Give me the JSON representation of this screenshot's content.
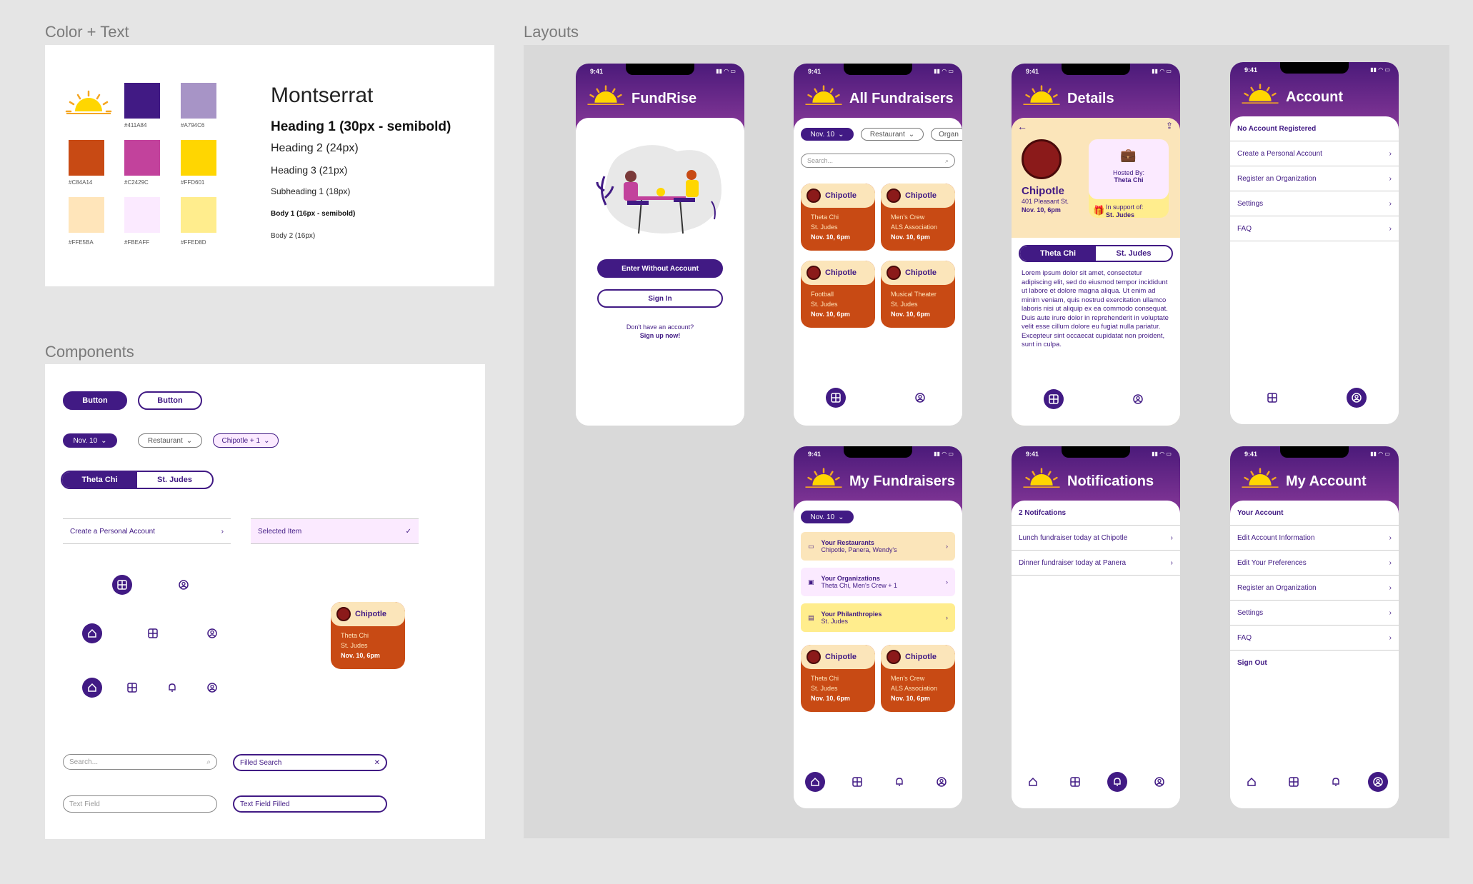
{
  "frames": {
    "color_text": "Color + Text",
    "components": "Components",
    "layouts": "Layouts"
  },
  "colors": [
    {
      "hex": "#411A84",
      "label": "#411A84"
    },
    {
      "hex": "#A794C6",
      "label": "#A794C6"
    },
    {
      "hex": "#C84A14",
      "label": "#C84A14"
    },
    {
      "hex": "#C2429C",
      "label": "#C2429C"
    },
    {
      "hex": "#FFD601",
      "label": "#FFD601"
    },
    {
      "hex": "#FFE5BA",
      "label": "#FFE5BA"
    },
    {
      "hex": "#FBEAFF",
      "label": "#FBEAFF"
    },
    {
      "hex": "#FFED8D",
      "label": "#FFED8D"
    }
  ],
  "typography": {
    "font": "Montserrat",
    "h1": "Heading 1 (30px - semibold)",
    "h2": "Heading 2 (24px)",
    "h3": "Heading 3 (21px)",
    "sub1": "Subheading 1 (18px)",
    "body1": "Body 1 (16px - semibold)",
    "body2": "Body 2 (16px)"
  },
  "components": {
    "button_filled": "Button",
    "button_outline": "Button",
    "date_pill": "Nov. 10",
    "restaurant_pill": "Restaurant",
    "chipotle_pill": "Chipotle + 1",
    "seg_left": "Theta Chi",
    "seg_right": "St. Judes",
    "list_item": "Create a Personal Account",
    "selected_item": "Selected Item",
    "card": {
      "name": "Chipotle",
      "org": "Theta Chi",
      "phil": "St. Judes",
      "time": "Nov. 10, 6pm"
    },
    "search_placeholder": "Search...",
    "search_filled": "Filled Search",
    "text_field": "Text Field",
    "text_field_filled": "Text Field Filled"
  },
  "status_time": "9:41",
  "screens": {
    "login": {
      "title": "FundRise",
      "enter_btn": "Enter Without Account",
      "signin_btn": "Sign In",
      "no_account": "Don't have an account?",
      "signup": "Sign up now!"
    },
    "all": {
      "title": "All Fundraisers",
      "filters": [
        "Nov. 10",
        "Restaurant",
        "Organ"
      ],
      "search": "Search...",
      "cards": [
        {
          "name": "Chipotle",
          "org": "Theta Chi",
          "phil": "St. Judes",
          "time": "Nov. 10, 6pm"
        },
        {
          "name": "Chipotle",
          "org": "Men's Crew",
          "phil": "ALS Association",
          "time": "Nov. 10, 6pm"
        },
        {
          "name": "Chipotle",
          "org": "Football",
          "phil": "St. Judes",
          "time": "Nov. 10, 6pm"
        },
        {
          "name": "Chipotle",
          "org": "Musical Theater",
          "phil": "St. Judes",
          "time": "Nov. 10, 6pm"
        }
      ]
    },
    "details": {
      "title": "Details",
      "name": "Chipotle",
      "address": "401 Pleasant St.",
      "time": "Nov. 10, 6pm",
      "hosted_label": "Hosted By:",
      "hosted": "Theta Chi",
      "support_label": "In support of:",
      "support": "St. Judes",
      "seg_left": "Theta Chi",
      "seg_right": "St. Judes",
      "lorem": "Lorem ipsum dolor sit amet, consectetur adipiscing elit, sed do eiusmod tempor incididunt ut labore et dolore magna aliqua. Ut enim ad minim veniam, quis nostrud exercitation ullamco laboris nisi ut aliquip ex ea commodo consequat. Duis aute irure dolor in reprehenderit in voluptate velit esse cillum dolore eu fugiat nulla pariatur. Excepteur sint occaecat cupidatat non proident, sunt in culpa."
    },
    "account": {
      "title": "Account",
      "header": "No Account Registered",
      "items": [
        "Create a Personal Account",
        "Register an Organization",
        "Settings",
        "FAQ"
      ]
    },
    "my": {
      "title": "My Fundraisers",
      "date": "Nov. 10",
      "groups": [
        {
          "title": "Your Restaurants",
          "sub": "Chipotle, Panera, Wendy's"
        },
        {
          "title": "Your Organizations",
          "sub": "Theta Chi, Men's Crew + 1"
        },
        {
          "title": "Your Philanthropies",
          "sub": "St. Judes"
        }
      ],
      "cards": [
        {
          "name": "Chipotle",
          "org": "Theta Chi",
          "phil": "St. Judes",
          "time": "Nov. 10, 6pm"
        },
        {
          "name": "Chipotle",
          "org": "Men's Crew",
          "phil": "ALS Association",
          "time": "Nov. 10, 6pm"
        }
      ]
    },
    "notif": {
      "title": "Notifications",
      "header": "2 Notifcations",
      "items": [
        "Lunch fundraiser today at Chipotle",
        "Dinner fundraiser today at Panera"
      ]
    },
    "myacct": {
      "title": "My Account",
      "header": "Your Account",
      "items": [
        "Edit Account Information",
        "Edit Your Preferences",
        "Register an Organization",
        "Settings",
        "FAQ"
      ],
      "signout": "Sign Out"
    }
  }
}
